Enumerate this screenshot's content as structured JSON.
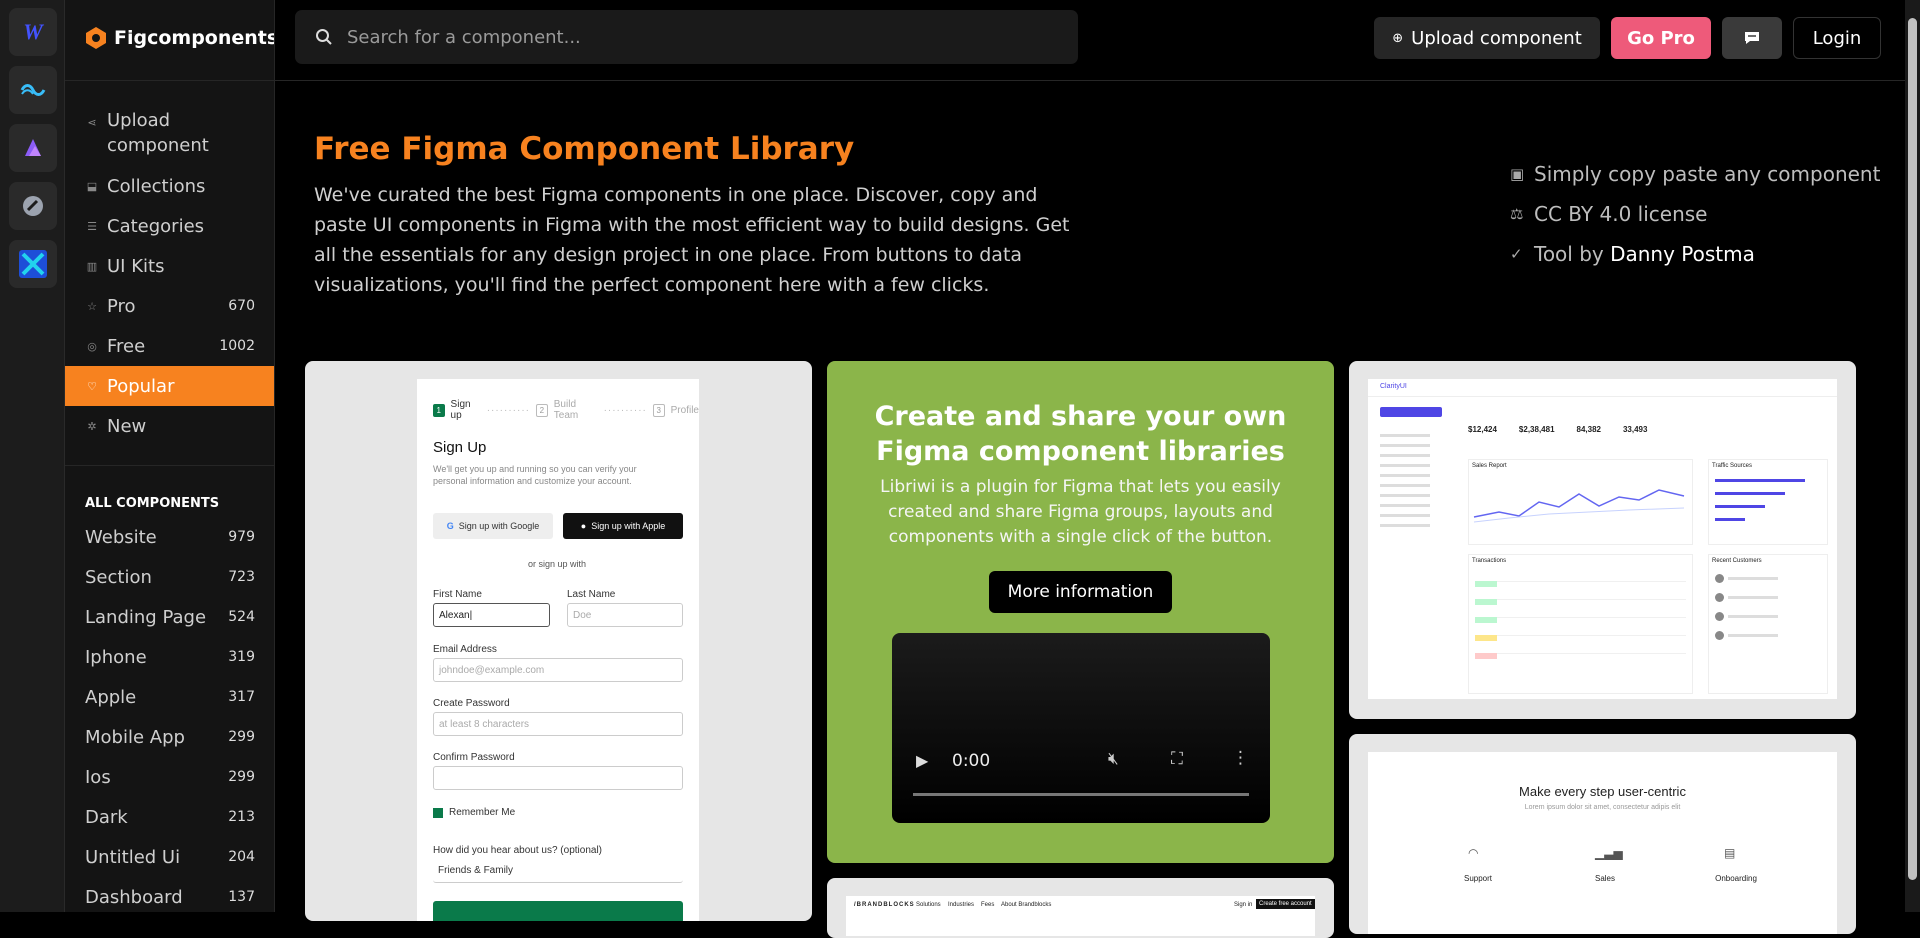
{
  "rail": {
    "icons": [
      "webflow-icon",
      "tailwind-icon",
      "figma-plugin-icon",
      "rocket-icon",
      "xd-icon"
    ]
  },
  "brand": {
    "name": "Figcomponents"
  },
  "nav": [
    {
      "label": "Upload component",
      "icon": "share-icon",
      "count": ""
    },
    {
      "label": "Collections",
      "icon": "lock-icon",
      "count": ""
    },
    {
      "label": "Categories",
      "icon": "list-icon",
      "count": ""
    },
    {
      "label": "UI Kits",
      "icon": "grid-icon",
      "count": ""
    },
    {
      "label": "Pro",
      "icon": "star-icon",
      "count": "670"
    },
    {
      "label": "Free",
      "icon": "coin-icon",
      "count": "1002"
    },
    {
      "label": "Popular",
      "icon": "heart-icon",
      "count": ""
    },
    {
      "label": "New",
      "icon": "sparkle-icon",
      "count": ""
    }
  ],
  "all_components": {
    "heading": "ALL COMPONENTS",
    "items": [
      {
        "label": "Website",
        "count": "979"
      },
      {
        "label": "Section",
        "count": "723"
      },
      {
        "label": "Landing Page",
        "count": "524"
      },
      {
        "label": "Iphone",
        "count": "319"
      },
      {
        "label": "Apple",
        "count": "317"
      },
      {
        "label": "Mobile App",
        "count": "299"
      },
      {
        "label": "Ios",
        "count": "299"
      },
      {
        "label": "Dark",
        "count": "213"
      },
      {
        "label": "Untitled Ui",
        "count": "204"
      },
      {
        "label": "Dashboard",
        "count": "137"
      }
    ]
  },
  "search": {
    "placeholder": "Search for a component..."
  },
  "header": {
    "upload": "Upload component",
    "gopro": "Go Pro",
    "login": "Login"
  },
  "colors": {
    "accent": "#f7821f",
    "gopro": "#ee5a7a",
    "promo": "#8bb54a"
  },
  "hero": {
    "title": "Free Figma Component Library",
    "description": "We've curated the best Figma components in one place. Discover, copy and paste UI components in Figma with the most efficient way to build designs. Get all the essentials for any design project in one place. From buttons to data visualizations, you'll find the perfect component here with a few clicks."
  },
  "features": [
    {
      "text": "Simply copy paste any component",
      "icon": "box-icon"
    },
    {
      "text": "CC BY 4.0 license",
      "icon": "scale-icon"
    },
    {
      "text": "Tool by ",
      "link": "Danny Postma",
      "icon": "check-circle-icon"
    }
  ],
  "promo": {
    "title": "Create and share your own Figma component libraries",
    "body": "Libriwi is a plugin for Figma that lets you easily created and share Figma groups, layouts and components with a single click of the button.",
    "button": "More information",
    "video_time": "0:00"
  },
  "signup_card": {
    "steps": [
      "Sign up",
      "Build Team",
      "Profile"
    ],
    "title": "Sign Up",
    "subtitle": "We'll get you up and running so you can verify your personal information and customize your account.",
    "google": "Sign up with Google",
    "apple": "Sign up with Apple",
    "or": "or sign up with",
    "first_name": "First Name",
    "first_value": "Alexan|",
    "last_name": "Last Name",
    "last_placeholder": "Doe",
    "email": "Email Address",
    "email_placeholder": "johndoe@example.com",
    "password": "Create Password",
    "password_placeholder": "at least 8 characters",
    "confirm": "Confirm Password",
    "remember": "Remember Me",
    "hear": "How did you hear about us? (optional)",
    "hear_value": "Friends & Family"
  },
  "dashboard_card": {
    "brand": "ClarityUI",
    "stats": [
      "$12,424",
      "$2,38,481",
      "84,382",
      "33,493"
    ],
    "sales": "Sales Report",
    "traffic": "Traffic Sources",
    "transactions": "Transactions",
    "customers": "Recent Customers"
  },
  "steps_card": {
    "title": "Make every step user-centric",
    "sub": "Lorem ipsum dolor sit amet, consectetur adipis elit",
    "cols": [
      "Support",
      "Sales",
      "Onboarding"
    ]
  },
  "brand_card": {
    "logo": "/BRANDBLOCKS",
    "links": [
      "Solutions",
      "Industries",
      "Fees",
      "About Brandblocks"
    ],
    "signin": "Sign in",
    "cta": "Create free account"
  }
}
